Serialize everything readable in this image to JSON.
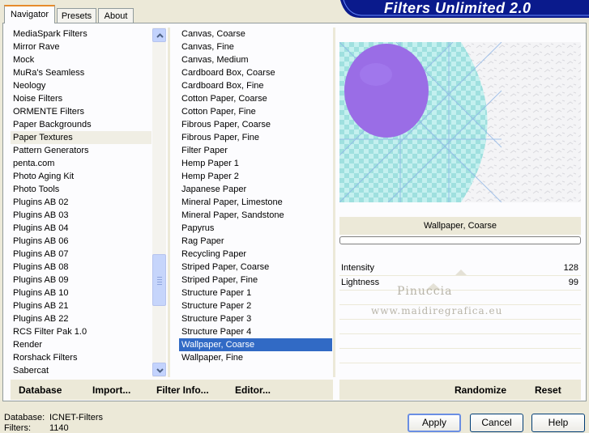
{
  "app": {
    "title": "Filters Unlimited 2.0"
  },
  "tabs": [
    {
      "label": "Navigator",
      "active": true
    },
    {
      "label": "Presets",
      "active": false
    },
    {
      "label": "About",
      "active": false
    }
  ],
  "categories": {
    "selected": "Paper Textures",
    "items": [
      "MediaSpark Filters",
      "Mirror Rave",
      "Mock",
      "MuRa's Seamless",
      "Neology",
      "Noise Filters",
      "ORMENTE Filters",
      "Paper Backgrounds",
      "Paper Textures",
      "Pattern Generators",
      "penta.com",
      "Photo Aging Kit",
      "Photo Tools",
      "Plugins AB 02",
      "Plugins AB 03",
      "Plugins AB 04",
      "Plugins AB 06",
      "Plugins AB 07",
      "Plugins AB 08",
      "Plugins AB 09",
      "Plugins AB 10",
      "Plugins AB 21",
      "Plugins AB 22",
      "RCS Filter Pak 1.0",
      "Render",
      "Rorshack Filters",
      "Sabercat"
    ]
  },
  "filters": {
    "selected": "Wallpaper, Coarse",
    "items": [
      "Canvas, Coarse",
      "Canvas, Fine",
      "Canvas, Medium",
      "Cardboard Box, Coarse",
      "Cardboard Box, Fine",
      "Cotton Paper, Coarse",
      "Cotton Paper, Fine",
      "Fibrous Paper, Coarse",
      "Fibrous Paper, Fine",
      "Filter Paper",
      "Hemp Paper 1",
      "Hemp Paper 2",
      "Japanese Paper",
      "Mineral Paper, Limestone",
      "Mineral Paper, Sandstone",
      "Papyrus",
      "Rag Paper",
      "Recycling Paper",
      "Striped Paper, Coarse",
      "Striped Paper, Fine",
      "Structure Paper 1",
      "Structure Paper 2",
      "Structure Paper 3",
      "Structure Paper 4",
      "Wallpaper, Coarse",
      "Wallpaper, Fine"
    ]
  },
  "preview": {
    "filter_name": "Wallpaper, Coarse"
  },
  "params": [
    {
      "label": "Intensity",
      "value": "128"
    },
    {
      "label": "Lightness",
      "value": "99"
    }
  ],
  "watermark": {
    "line1": "Pinuccia",
    "line2": "www.maidiregrafica.eu"
  },
  "bottom_links": {
    "database": "Database",
    "import": "Import...",
    "filter_info": "Filter Info...",
    "editor": "Editor...",
    "randomize": "Randomize",
    "reset": "Reset"
  },
  "status": {
    "database_label": "Database:",
    "database_value": "ICNET-Filters",
    "filters_label": "Filters:",
    "filters_value": "1140"
  },
  "buttons": {
    "apply": "Apply",
    "cancel": "Cancel",
    "help": "Help"
  },
  "colors": {
    "selection": "#316ac5",
    "banner": "#0a1a8c",
    "preview_purple": "#9a6de6",
    "preview_cyan": "#bfeeee"
  }
}
